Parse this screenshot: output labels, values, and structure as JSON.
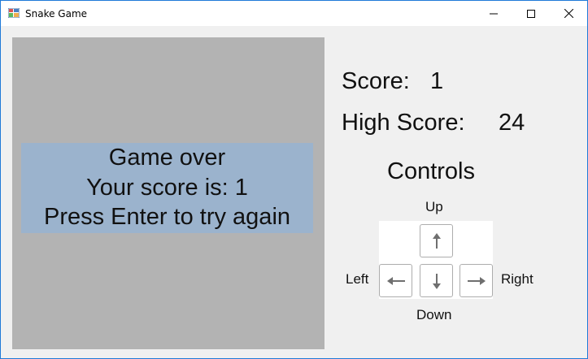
{
  "window": {
    "title": "Snake Game",
    "icon": "window-app-icon",
    "controls": [
      "minimize-icon",
      "maximize-icon",
      "close-icon"
    ]
  },
  "game_over": {
    "line1": "Game over",
    "line2": "Your score is: 1",
    "line3": "Press Enter to try again"
  },
  "score": {
    "label": "Score:",
    "value": "1"
  },
  "high_score": {
    "label": "High Score:",
    "value": "24"
  },
  "controls": {
    "title": "Controls",
    "up_label": "Up",
    "down_label": "Down",
    "left_label": "Left",
    "right_label": "Right",
    "icons": [
      "arrow-up-icon",
      "arrow-down-icon",
      "arrow-left-icon",
      "arrow-right-icon"
    ]
  },
  "colors": {
    "board": "#b3b3b3",
    "gameover_panel": "#9bb3cd",
    "window_bg": "#f0f0f0",
    "arrow": "#6f6f6f"
  }
}
